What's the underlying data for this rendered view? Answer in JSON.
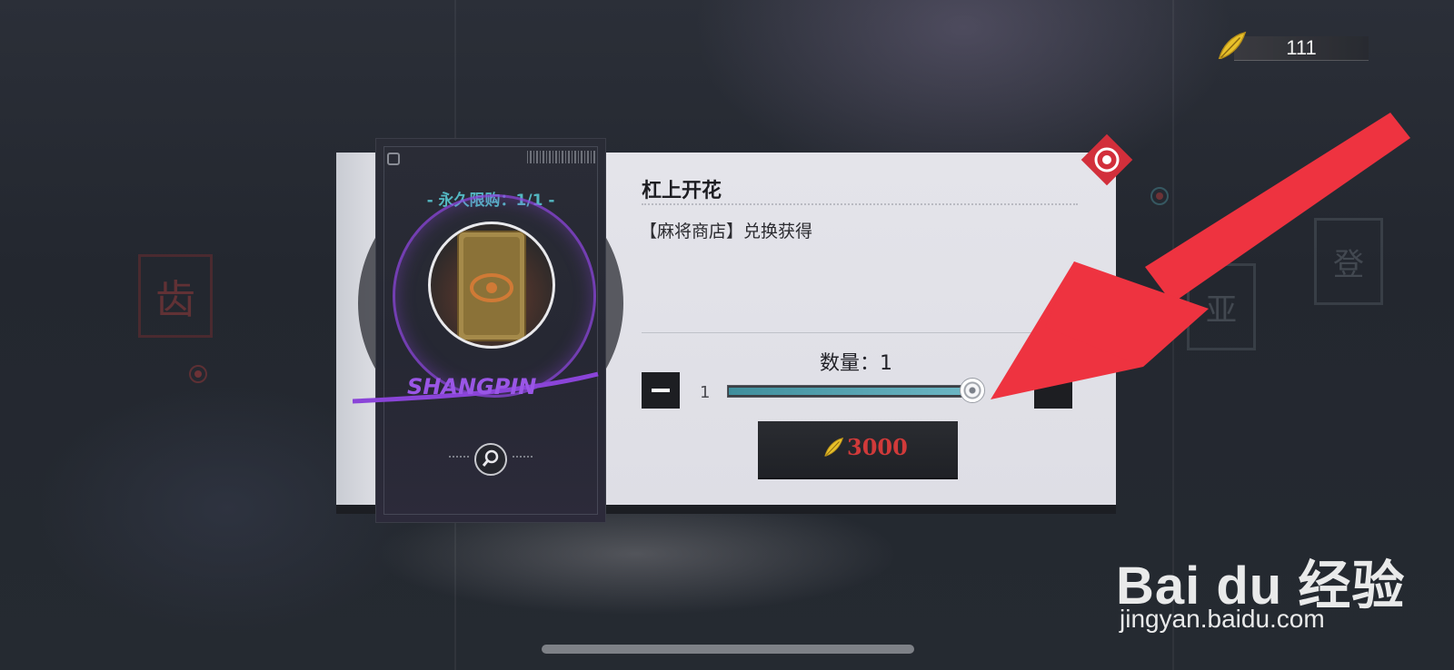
{
  "currency": {
    "icon": "golden-feather-icon",
    "amount": "111"
  },
  "item": {
    "purchase_limit": "- 永久限购：1/1 -",
    "name": "杠上开花",
    "source": "【麻将商店】兑换获得",
    "card_signature": "SHANGPIN"
  },
  "purchase": {
    "quantity_label": "数量：1",
    "min_value": "1",
    "quantity_fraction": 1.0,
    "price": "3000",
    "price_icon": "golden-feather-icon",
    "price_color": "#d03a3a"
  },
  "watermark": {
    "brand": "Bai du 经验",
    "url": "jingyan.baidu.com"
  },
  "colors": {
    "accent": "#53b7c1",
    "arrow": "#ee3340"
  }
}
